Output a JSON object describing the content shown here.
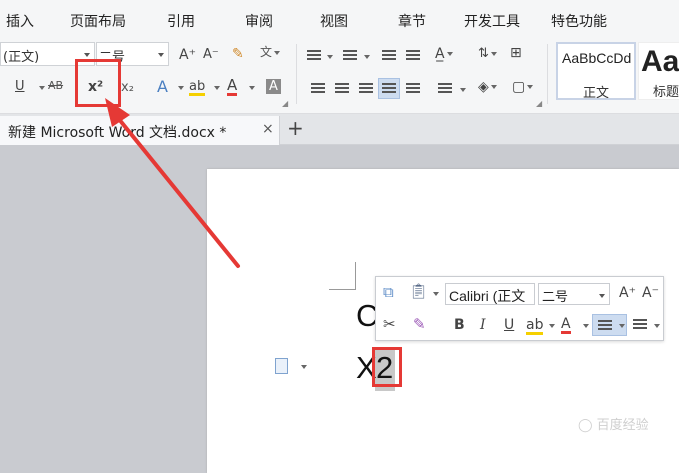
{
  "menubar": {
    "items": [
      "插入",
      "页面布局",
      "引用",
      "审阅",
      "视图",
      "章节",
      "开发工具",
      "特色功能"
    ]
  },
  "ribbon": {
    "font_name": "(正文)",
    "font_size": "二号",
    "grow_font": "A⁺",
    "shrink_font": "A⁻",
    "underline": "U",
    "strikethrough": "AB",
    "superscript": "x²",
    "subscript": "x₂",
    "text_effect": "A",
    "highlight": "ab",
    "font_color": "A",
    "char_shading": "A",
    "styles": [
      {
        "sample": "AaBbCcDd",
        "name": "正文"
      },
      {
        "sample": "Aa",
        "name": "标题"
      }
    ]
  },
  "tabs": {
    "document_title": "新建 Microsoft Word 文档.docx *",
    "close": "×",
    "add": "+"
  },
  "document": {
    "line1": "C",
    "line2_base": "X",
    "line2_selected": "2"
  },
  "minibar": {
    "font_name": "Calibri (正文",
    "font_size": "二号",
    "bold": "B",
    "italic": "I",
    "underline": "U",
    "grow_font": "A⁺",
    "shrink_font": "A⁻"
  },
  "watermark": "◯ 百度经验",
  "colors": {
    "accent_red": "#e53935",
    "font_color_red": "#e53935",
    "highlight_yellow": "#f5d000",
    "selection_gray": "#c8c8c8"
  }
}
